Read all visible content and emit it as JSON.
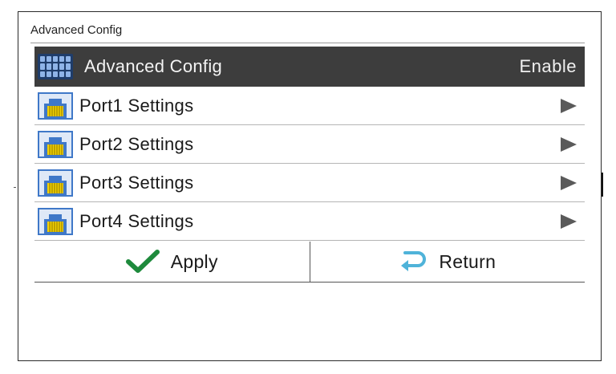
{
  "screen": {
    "title": "Advanced Config"
  },
  "header_row": {
    "icon": "grid-menu-icon",
    "label": "Advanced Config",
    "value": "Enable"
  },
  "ports": [
    {
      "icon": "ethernet-port-icon",
      "label": "Port1 Settings",
      "indicator": "arrow-right-icon"
    },
    {
      "icon": "ethernet-port-icon",
      "label": "Port2 Settings",
      "indicator": "arrow-right-icon"
    },
    {
      "icon": "ethernet-port-icon",
      "label": "Port3 Settings",
      "indicator": "arrow-right-icon"
    },
    {
      "icon": "ethernet-port-icon",
      "label": "Port4 Settings",
      "indicator": "arrow-right-icon"
    }
  ],
  "footer": {
    "apply_label": "Apply",
    "apply_icon": "checkmark-icon",
    "return_label": "Return",
    "return_icon": "return-arrow-icon"
  },
  "colors": {
    "header_bg": "#3d3d3d",
    "checkmark": "#1e8a3c",
    "return_arrow": "#4fb3d9",
    "port_icon_body": "#3f78c8",
    "port_icon_contacts": "#f1d000"
  }
}
